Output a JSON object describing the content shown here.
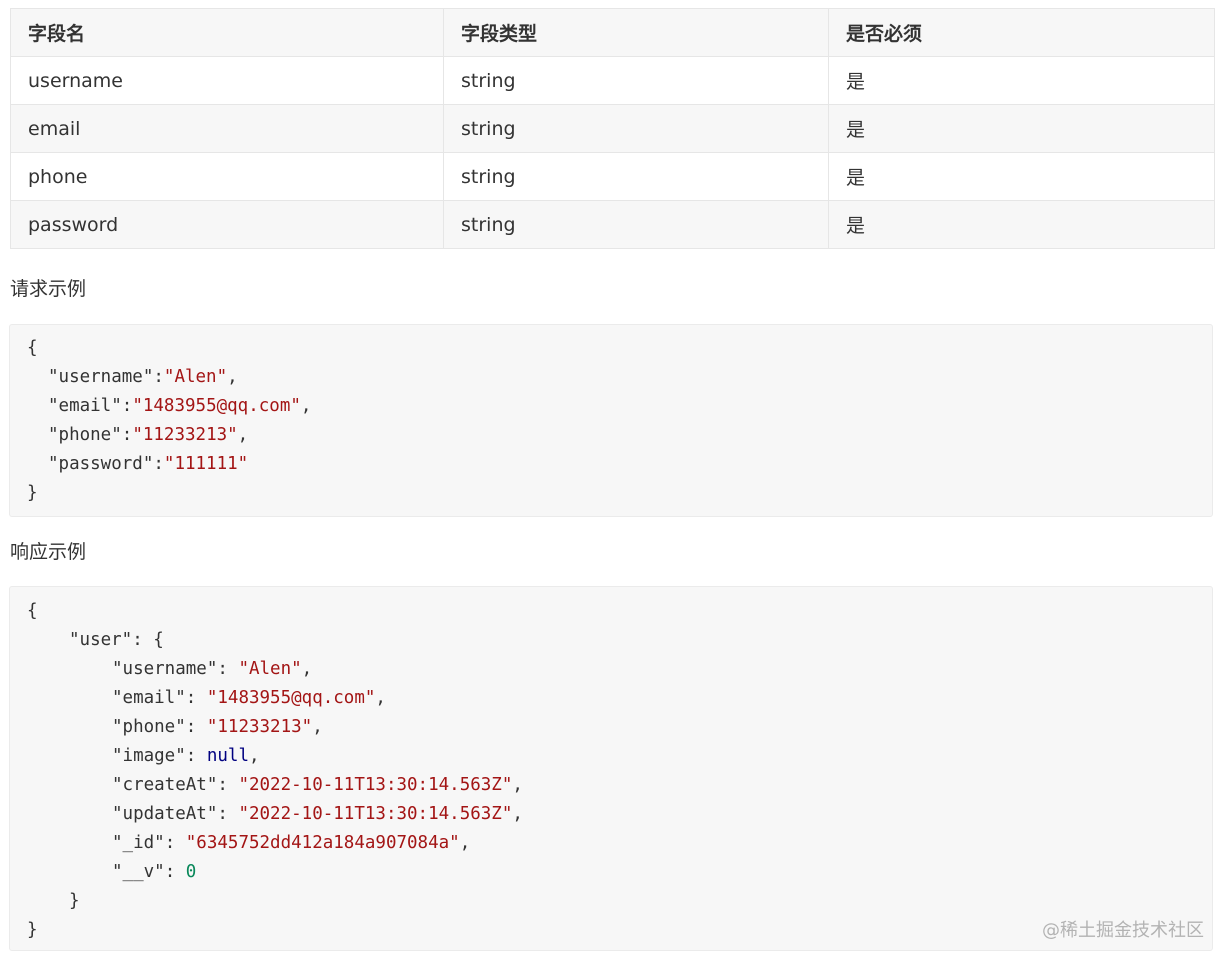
{
  "table": {
    "headers": [
      "字段名",
      "字段类型",
      "是否必须"
    ],
    "rows": [
      [
        "username",
        "string",
        "是"
      ],
      [
        "email",
        "string",
        "是"
      ],
      [
        "phone",
        "string",
        "是"
      ],
      [
        "password",
        "string",
        "是"
      ]
    ]
  },
  "request": {
    "label": "请求示例",
    "open": "{",
    "close": "}",
    "fields": [
      {
        "key": "\"username\"",
        "sep": ":",
        "value": "\"Alen\"",
        "trail": ","
      },
      {
        "key": "\"email\"",
        "sep": ":",
        "value": "\"1483955@qq.com\"",
        "trail": ","
      },
      {
        "key": "\"phone\"",
        "sep": ":",
        "value": "\"11233213\"",
        "trail": ","
      },
      {
        "key": "\"password\"",
        "sep": ":",
        "value": "\"111111\"",
        "trail": ""
      }
    ]
  },
  "response": {
    "label": "响应示例",
    "open": "{",
    "user_key": "\"user\"",
    "user_open": ": {",
    "user_close": "}",
    "close": "}",
    "fields": [
      {
        "key": "\"username\"",
        "sep": ": ",
        "value": "\"Alen\"",
        "type": "str",
        "trail": ","
      },
      {
        "key": "\"email\"",
        "sep": ": ",
        "value": "\"1483955@qq.com\"",
        "type": "str",
        "trail": ","
      },
      {
        "key": "\"phone\"",
        "sep": ": ",
        "value": "\"11233213\"",
        "type": "str",
        "trail": ","
      },
      {
        "key": "\"image\"",
        "sep": ": ",
        "value": "null",
        "type": "kw",
        "trail": ","
      },
      {
        "key": "\"createAt\"",
        "sep": ": ",
        "value": "\"2022-10-11T13:30:14.563Z\"",
        "type": "str",
        "trail": ","
      },
      {
        "key": "\"updateAt\"",
        "sep": ": ",
        "value": "\"2022-10-11T13:30:14.563Z\"",
        "type": "str",
        "trail": ","
      },
      {
        "key": "\"_id\"",
        "sep": ": ",
        "value": "\"6345752dd412a184a907084a\"",
        "type": "str",
        "trail": ","
      },
      {
        "key": "\"__v\"",
        "sep": ": ",
        "value": "0",
        "type": "num",
        "trail": ""
      }
    ]
  },
  "watermark": "@稀土掘金技术社区",
  "colors": {
    "string": "#a31515",
    "keyword": "#000080",
    "number": "#09885a",
    "code_bg": "#f7f7f7"
  }
}
